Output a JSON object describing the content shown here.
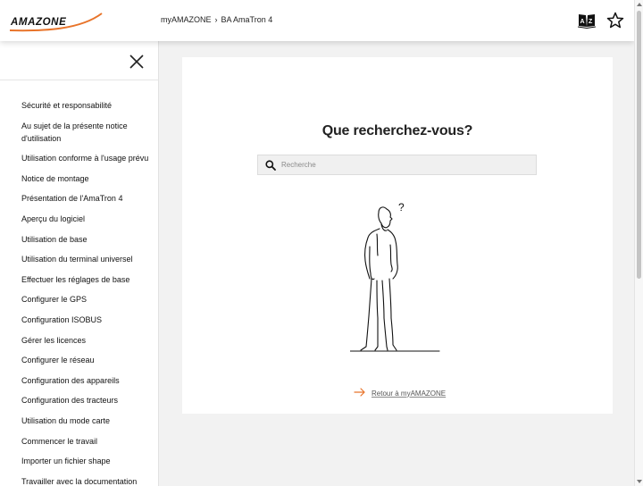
{
  "header": {
    "logo_text": "AMAZONE",
    "breadcrumb": [
      "myAMAZONE",
      "›",
      "BA AmaTron 4"
    ],
    "icons": [
      "dictionary-icon",
      "star-icon"
    ]
  },
  "sidebar": {
    "close_icon": "close-icon",
    "items": [
      {
        "label": "Sécurité et responsabilité"
      },
      {
        "label": "Au sujet de la présente notice d'utilisation"
      },
      {
        "label": "Utilisation conforme à l'usage prévu"
      },
      {
        "label": "Notice de montage"
      },
      {
        "label": "Présentation de l'AmaTron 4"
      },
      {
        "label": "Aperçu du logiciel"
      },
      {
        "label": "Utilisation de base"
      },
      {
        "label": "Utilisation du terminal universel"
      },
      {
        "label": "Effectuer les réglages de base"
      },
      {
        "label": "Configurer le GPS"
      },
      {
        "label": "Configuration ISOBUS"
      },
      {
        "label": "Gérer les licences"
      },
      {
        "label": "Configurer le réseau"
      },
      {
        "label": "Configuration des appareils"
      },
      {
        "label": "Configuration des tracteurs"
      },
      {
        "label": "Utilisation du mode carte"
      },
      {
        "label": "Commencer le travail"
      },
      {
        "label": "Importer un fichier shape"
      },
      {
        "label": "Travailler avec la documentation"
      }
    ]
  },
  "main": {
    "title": "Que recherchez-vous?",
    "search": {
      "placeholder": "Recherche",
      "value": ""
    },
    "figure_mark": "?",
    "back_link": "Retour à myAMAZONE"
  },
  "colors": {
    "accent": "#e8742a",
    "background": "#f2f2f2",
    "card": "#ffffff",
    "text": "#1a1a1a"
  }
}
